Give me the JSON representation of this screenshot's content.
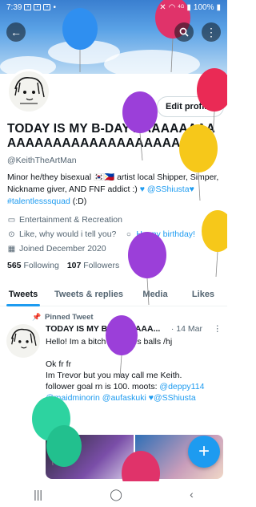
{
  "status_bar": {
    "time": "7:39",
    "battery": "100%",
    "signal": "4G"
  },
  "profile": {
    "name": "TODAY IS MY B-DAY AAAAAAAAA AAAAAAAAAAAAAAAAAAAAAAA",
    "handle": "@KeithTheArtMan",
    "edit_label": "Edit profile",
    "bio": {
      "text1": "Minor  he/they  bisexual",
      "flags": "🇰🇷🇵🇭",
      "text2": "artist  local Shipper, Simper, Nickname giver, AND FNF addict :)",
      "mention": "@SShiusta",
      "hashtag": "#talentlesssquad",
      "tail": "(:D)"
    },
    "category": "Entertainment & Recreation",
    "location": "Like, why would i tell you?",
    "birthday": "Happy birthday!",
    "joined": "Joined December 2020",
    "following_count": "565",
    "following_label": "Following",
    "followers_count": "107",
    "followers_label": "Followers"
  },
  "tabs": [
    "Tweets",
    "Tweets & replies",
    "Media",
    "Likes"
  ],
  "pinned_tweet": {
    "pinned_label": "Pinned Tweet",
    "author": "TODAY IS MY B-DAY AAAA...",
    "date": "· 14 Mar",
    "line1": "Hello! Im a bitch that likes balls /hj",
    "line2": "Ok fr fr",
    "line3": "Im Trevor but you may call me Keith.",
    "line4a": "follower goal rn is 100. moots: ",
    "m1": "@deppy114",
    "m2": "@maidminorin",
    "m3": "@aufaskuki",
    "m4": "@SShiusta"
  },
  "colors": {
    "accent": "#1d9bf0",
    "text": "#0f1419",
    "muted": "#536471"
  },
  "icons": {
    "back": "arrow-left-icon",
    "search": "search-icon",
    "more": "more-vertical-icon",
    "category": "briefcase-icon",
    "location": "location-pin-icon",
    "birthday": "balloon-icon",
    "calendar": "calendar-icon",
    "pin": "pin-icon",
    "fab": "plus-icon"
  }
}
